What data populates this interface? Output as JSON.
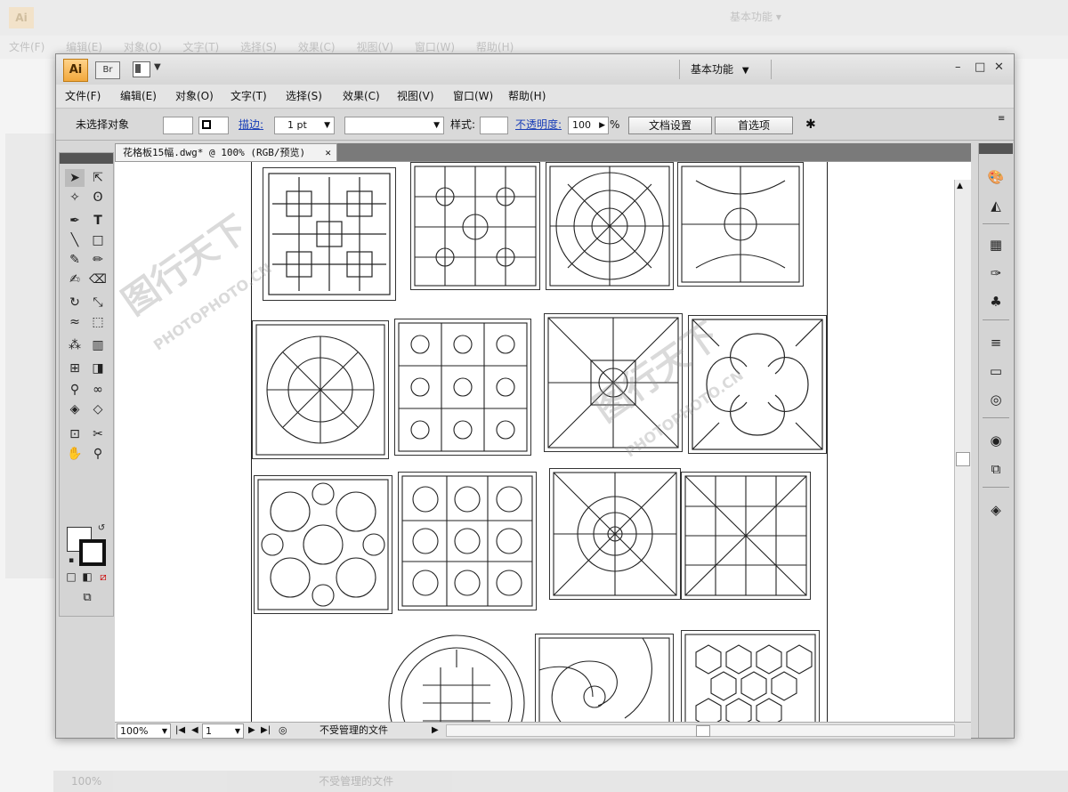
{
  "background": {
    "app_icon": "Ai",
    "workspace": "基本功能 ▾",
    "menu": [
      "文件(F)",
      "编辑(E)",
      "对象(O)",
      "文字(T)",
      "选择(S)",
      "效果(C)",
      "视图(V)",
      "窗口(W)",
      "帮助(H)"
    ],
    "status_zoom": "100%",
    "status_text": "不受管理的文件"
  },
  "titlebar": {
    "app_icon": "Ai",
    "bridge": "Br",
    "workspace": "基本功能",
    "minimize": "–",
    "maximize": "□",
    "close": "✕"
  },
  "menubar": {
    "items": [
      "文件(F)",
      "编辑(E)",
      "对象(O)",
      "文字(T)",
      "选择(S)",
      "效果(C)",
      "视图(V)",
      "窗口(W)",
      "帮助(H)"
    ]
  },
  "control": {
    "selection": "未选择对象",
    "stroke_label": "描边:",
    "stroke_value": "1 pt",
    "style_label": "样式:",
    "opacity_label": "不透明度:",
    "opacity_value": "100",
    "percent": "%",
    "doc_setup": "文档设置",
    "prefs": "首选项"
  },
  "document": {
    "tab_title": "花格板15幅.dwg* @ 100% (RGB/预览)",
    "tab_close": "✕"
  },
  "statusbar": {
    "zoom": "100%",
    "page": "1",
    "info": "不受管理的文件"
  },
  "watermark": {
    "brand": "图行天下",
    "sub": "PHOTOPHOTO.CN"
  },
  "tool_icons": [
    "selection-tool",
    "direct-selection-tool",
    "magic-wand-tool",
    "lasso-tool",
    "pen-tool",
    "type-tool",
    "line-tool",
    "rectangle-tool",
    "paintbrush-tool",
    "pencil-tool",
    "blob-brush-tool",
    "eraser-tool",
    "rotate-tool",
    "scale-tool",
    "warp-tool",
    "free-transform-tool",
    "symbol-sprayer-tool",
    "graph-tool",
    "mesh-tool",
    "gradient-tool",
    "eyedropper-tool",
    "blend-tool",
    "live-paint-tool",
    "live-paint-selection-tool",
    "artboard-tool",
    "slice-tool",
    "hand-tool",
    "zoom-tool"
  ],
  "panel_icons": [
    "color-panel-icon",
    "color-guide-icon",
    "swatches-icon",
    "brushes-icon",
    "symbols-icon",
    "stroke-icon",
    "gradient-icon",
    "transparency-icon",
    "appearance-icon",
    "graphic-styles-icon",
    "layers-icon"
  ]
}
